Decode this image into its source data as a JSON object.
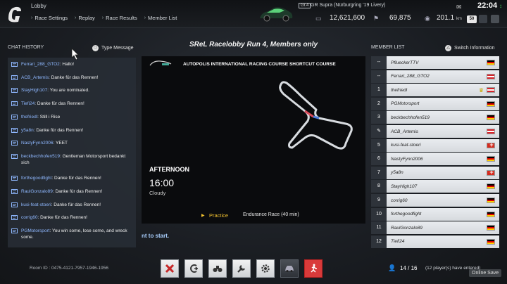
{
  "topbar": {
    "title": "Lobby",
    "menu": [
      "Race Settings",
      "Replay",
      "Race Results",
      "Member List"
    ],
    "car_class": "Gr.4",
    "car_name": "GR Supra (Nürburgring '19 Livery)",
    "credits": "12,621,600",
    "points": "69,875",
    "distance": "201.1",
    "distance_unit": "km",
    "clock": "22:04",
    "level": "50"
  },
  "chat": {
    "header": "CHAT HISTORY",
    "type_message": "Type Message",
    "messages": [
      {
        "name": "Ferrari_288_GTO2",
        "text": "Hallo!"
      },
      {
        "name": "ACB_Artemis",
        "text": "Danke für das Rennen!"
      },
      {
        "name": "StayHigh107",
        "text": "You are nominated."
      },
      {
        "name": "Tiefi24",
        "text": "Danke für das Rennen!"
      },
      {
        "name": "thefriedl",
        "text": "Still i Rise"
      },
      {
        "name": "y5a8n",
        "text": "Danke für das Rennen!"
      },
      {
        "name": "NastyFynn2006",
        "text": "YEET"
      },
      {
        "name": "beckbechhofen519",
        "text": "Gentleman Motorsport bedankt sich"
      },
      {
        "name": "forthegoodfight",
        "text": "Danke für das Rennen!"
      },
      {
        "name": "RaulGonzalo89",
        "text": "Danke für das Rennen!"
      },
      {
        "name": "kusi-feat-stoeri",
        "text": "Danke für das Rennen!"
      },
      {
        "name": "corrig60",
        "text": "Danke für das Rennen!"
      },
      {
        "name": "PGMotorsport",
        "text": "You win some, lose some, and wreck some."
      }
    ]
  },
  "lobby": {
    "name": "SReL Racelobby Run 4, Members only",
    "track_name": "AUTOPOLIS INTERNATIONAL RACING COURSE  SHORTCUT COURSE",
    "time_of_day": "AFTERNOON",
    "time": "16:00",
    "weather": "Cloudy",
    "session_current": "Practice",
    "session_next": "Endurance Race (40 min)",
    "start_hint": "nt to start."
  },
  "members": {
    "header": "MEMBER LIST",
    "switch_info": "Switch Information",
    "list": [
      {
        "rank": "--",
        "name": "PflueckerTTV",
        "flag": "de"
      },
      {
        "rank": "--",
        "name": "Ferrari_288_GTO2",
        "flag": "at"
      },
      {
        "rank": "1",
        "name": "thefriedl",
        "flag": "at",
        "host": true
      },
      {
        "rank": "2",
        "name": "PGMotorsport",
        "flag": "de"
      },
      {
        "rank": "3",
        "name": "beckbechhofen519",
        "flag": "de"
      },
      {
        "rank": "✎",
        "name": "ACB_Artemis",
        "flag": "at"
      },
      {
        "rank": "5",
        "name": "kusi-feat-stoeri",
        "flag": "ch"
      },
      {
        "rank": "6",
        "name": "NastyFynn2006",
        "flag": "de"
      },
      {
        "rank": "7",
        "name": "y5a8n",
        "flag": "ch"
      },
      {
        "rank": "8",
        "name": "StayHigh107",
        "flag": "de"
      },
      {
        "rank": "9",
        "name": "corrig60",
        "flag": "de"
      },
      {
        "rank": "10",
        "name": "forthegoodfight",
        "flag": "de"
      },
      {
        "rank": "11",
        "name": "RaulGonzalo89",
        "flag": "de"
      },
      {
        "rank": "12",
        "name": "Tiefi24",
        "flag": "de"
      }
    ]
  },
  "bottom": {
    "room_id": "Room ID : 0475-4121-7957-1946-1956",
    "players": "14 / 16",
    "players_entered": "(12 player(s) have entered)",
    "online_save": "Online Save"
  },
  "colors": {
    "accent_blue": "#8fb8ff",
    "session_yellow": "#f2c230",
    "exit_red": "#d93a3a"
  }
}
